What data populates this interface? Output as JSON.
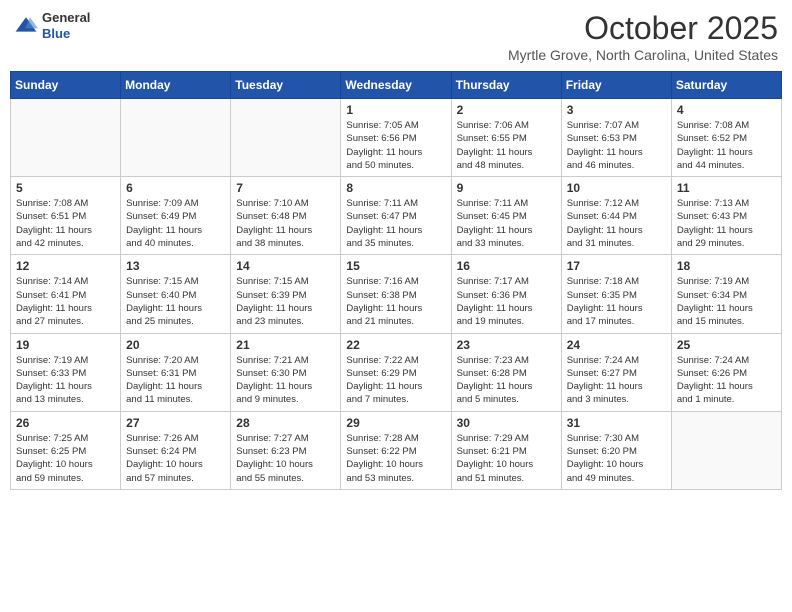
{
  "header": {
    "logo_general": "General",
    "logo_blue": "Blue",
    "month": "October 2025",
    "location": "Myrtle Grove, North Carolina, United States"
  },
  "weekdays": [
    "Sunday",
    "Monday",
    "Tuesday",
    "Wednesday",
    "Thursday",
    "Friday",
    "Saturday"
  ],
  "weeks": [
    [
      {
        "day": "",
        "info": ""
      },
      {
        "day": "",
        "info": ""
      },
      {
        "day": "",
        "info": ""
      },
      {
        "day": "1",
        "info": "Sunrise: 7:05 AM\nSunset: 6:56 PM\nDaylight: 11 hours\nand 50 minutes."
      },
      {
        "day": "2",
        "info": "Sunrise: 7:06 AM\nSunset: 6:55 PM\nDaylight: 11 hours\nand 48 minutes."
      },
      {
        "day": "3",
        "info": "Sunrise: 7:07 AM\nSunset: 6:53 PM\nDaylight: 11 hours\nand 46 minutes."
      },
      {
        "day": "4",
        "info": "Sunrise: 7:08 AM\nSunset: 6:52 PM\nDaylight: 11 hours\nand 44 minutes."
      }
    ],
    [
      {
        "day": "5",
        "info": "Sunrise: 7:08 AM\nSunset: 6:51 PM\nDaylight: 11 hours\nand 42 minutes."
      },
      {
        "day": "6",
        "info": "Sunrise: 7:09 AM\nSunset: 6:49 PM\nDaylight: 11 hours\nand 40 minutes."
      },
      {
        "day": "7",
        "info": "Sunrise: 7:10 AM\nSunset: 6:48 PM\nDaylight: 11 hours\nand 38 minutes."
      },
      {
        "day": "8",
        "info": "Sunrise: 7:11 AM\nSunset: 6:47 PM\nDaylight: 11 hours\nand 35 minutes."
      },
      {
        "day": "9",
        "info": "Sunrise: 7:11 AM\nSunset: 6:45 PM\nDaylight: 11 hours\nand 33 minutes."
      },
      {
        "day": "10",
        "info": "Sunrise: 7:12 AM\nSunset: 6:44 PM\nDaylight: 11 hours\nand 31 minutes."
      },
      {
        "day": "11",
        "info": "Sunrise: 7:13 AM\nSunset: 6:43 PM\nDaylight: 11 hours\nand 29 minutes."
      }
    ],
    [
      {
        "day": "12",
        "info": "Sunrise: 7:14 AM\nSunset: 6:41 PM\nDaylight: 11 hours\nand 27 minutes."
      },
      {
        "day": "13",
        "info": "Sunrise: 7:15 AM\nSunset: 6:40 PM\nDaylight: 11 hours\nand 25 minutes."
      },
      {
        "day": "14",
        "info": "Sunrise: 7:15 AM\nSunset: 6:39 PM\nDaylight: 11 hours\nand 23 minutes."
      },
      {
        "day": "15",
        "info": "Sunrise: 7:16 AM\nSunset: 6:38 PM\nDaylight: 11 hours\nand 21 minutes."
      },
      {
        "day": "16",
        "info": "Sunrise: 7:17 AM\nSunset: 6:36 PM\nDaylight: 11 hours\nand 19 minutes."
      },
      {
        "day": "17",
        "info": "Sunrise: 7:18 AM\nSunset: 6:35 PM\nDaylight: 11 hours\nand 17 minutes."
      },
      {
        "day": "18",
        "info": "Sunrise: 7:19 AM\nSunset: 6:34 PM\nDaylight: 11 hours\nand 15 minutes."
      }
    ],
    [
      {
        "day": "19",
        "info": "Sunrise: 7:19 AM\nSunset: 6:33 PM\nDaylight: 11 hours\nand 13 minutes."
      },
      {
        "day": "20",
        "info": "Sunrise: 7:20 AM\nSunset: 6:31 PM\nDaylight: 11 hours\nand 11 minutes."
      },
      {
        "day": "21",
        "info": "Sunrise: 7:21 AM\nSunset: 6:30 PM\nDaylight: 11 hours\nand 9 minutes."
      },
      {
        "day": "22",
        "info": "Sunrise: 7:22 AM\nSunset: 6:29 PM\nDaylight: 11 hours\nand 7 minutes."
      },
      {
        "day": "23",
        "info": "Sunrise: 7:23 AM\nSunset: 6:28 PM\nDaylight: 11 hours\nand 5 minutes."
      },
      {
        "day": "24",
        "info": "Sunrise: 7:24 AM\nSunset: 6:27 PM\nDaylight: 11 hours\nand 3 minutes."
      },
      {
        "day": "25",
        "info": "Sunrise: 7:24 AM\nSunset: 6:26 PM\nDaylight: 11 hours\nand 1 minute."
      }
    ],
    [
      {
        "day": "26",
        "info": "Sunrise: 7:25 AM\nSunset: 6:25 PM\nDaylight: 10 hours\nand 59 minutes."
      },
      {
        "day": "27",
        "info": "Sunrise: 7:26 AM\nSunset: 6:24 PM\nDaylight: 10 hours\nand 57 minutes."
      },
      {
        "day": "28",
        "info": "Sunrise: 7:27 AM\nSunset: 6:23 PM\nDaylight: 10 hours\nand 55 minutes."
      },
      {
        "day": "29",
        "info": "Sunrise: 7:28 AM\nSunset: 6:22 PM\nDaylight: 10 hours\nand 53 minutes."
      },
      {
        "day": "30",
        "info": "Sunrise: 7:29 AM\nSunset: 6:21 PM\nDaylight: 10 hours\nand 51 minutes."
      },
      {
        "day": "31",
        "info": "Sunrise: 7:30 AM\nSunset: 6:20 PM\nDaylight: 10 hours\nand 49 minutes."
      },
      {
        "day": "",
        "info": ""
      }
    ]
  ]
}
